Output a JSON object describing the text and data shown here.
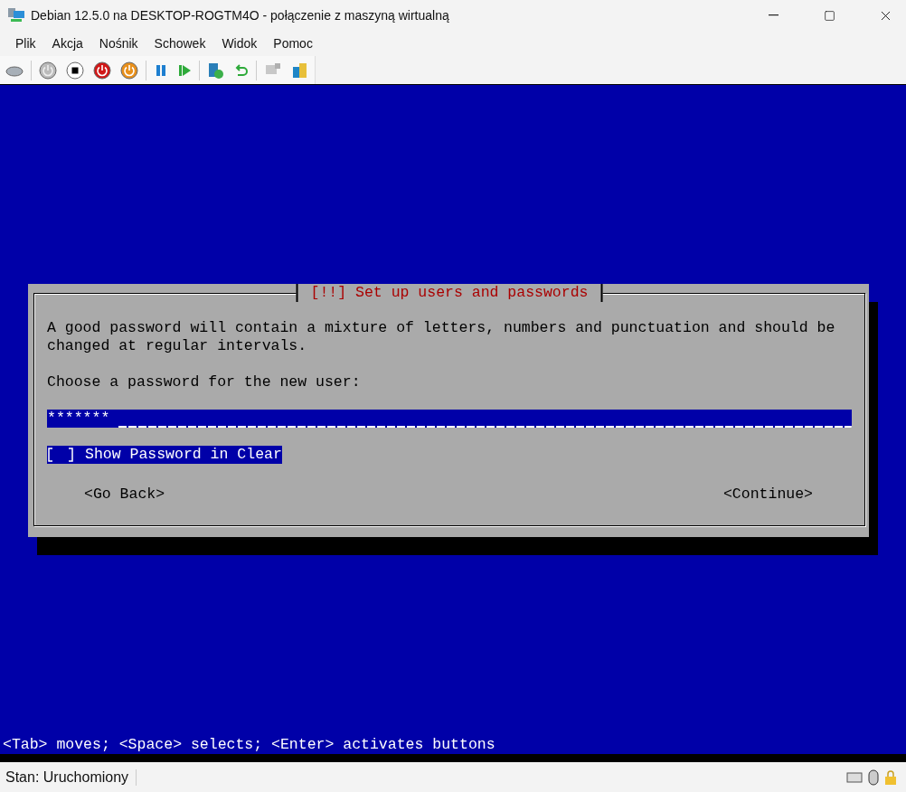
{
  "window": {
    "title": "Debian 12.5.0 na DESKTOP-ROGTM4O - połączenie z maszyną wirtualną"
  },
  "menu": [
    "Plik",
    "Akcja",
    "Nośnik",
    "Schowek",
    "Widok",
    "Pomoc"
  ],
  "dialog": {
    "title": "[!!] Set up users and passwords",
    "paragraphs": [
      "A good password will contain a mixture of letters, numbers and punctuation and should be changed at regular intervals.",
      "Choose a password for the new user:"
    ],
    "password": {
      "value": "*******"
    },
    "checkbox": {
      "label": "Show Password in Clear",
      "checked": false,
      "focused": true
    },
    "buttons": [
      "<Go Back>",
      "<Continue>"
    ]
  },
  "hint": "<Tab> moves; <Space> selects; <Enter> activates buttons",
  "status_bar": {
    "text": "Stan: Uruchomiony"
  }
}
